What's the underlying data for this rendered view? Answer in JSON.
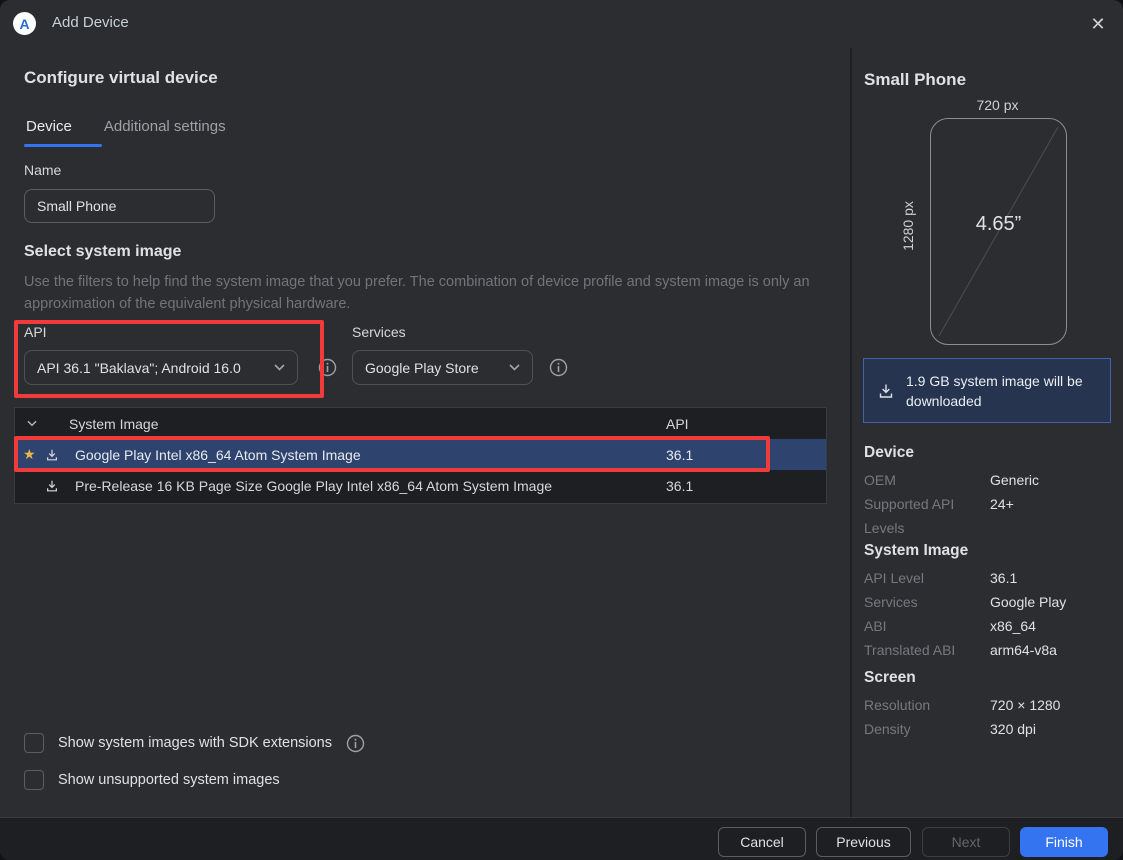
{
  "titlebar": {
    "title": "Add Device",
    "close_icon": "✕",
    "logo_letter": "A"
  },
  "header": {
    "heading": "Configure virtual device"
  },
  "tabs": [
    {
      "label": "Device",
      "active": true
    },
    {
      "label": "Additional settings",
      "active": false
    }
  ],
  "name_field": {
    "label": "Name",
    "value": "Small Phone"
  },
  "system_image_section": {
    "heading": "Select system image",
    "description": "Use the filters to help find the system image that you prefer. The combination of device profile and system image is only an approximation of the equivalent physical hardware."
  },
  "filters": {
    "api": {
      "label": "API",
      "value": "API 36.1 \"Baklava\"; Android 16.0"
    },
    "services": {
      "label": "Services",
      "value": "Google Play Store"
    }
  },
  "table": {
    "columns": {
      "system_image": "System Image",
      "api": "API"
    },
    "rows": [
      {
        "name": "Google Play Intel x86_64 Atom System Image",
        "api": "36.1",
        "selected": true,
        "starred": true
      },
      {
        "name": "Pre-Release 16 KB Page Size Google Play Intel x86_64 Atom System Image",
        "api": "36.1",
        "selected": false,
        "starred": false
      }
    ]
  },
  "checkboxes": [
    {
      "label": "Show system images with SDK extensions",
      "checked": false
    },
    {
      "label": "Show unsupported system images",
      "checked": false
    }
  ],
  "footer": {
    "cancel": "Cancel",
    "previous": "Previous",
    "next": "Next",
    "finish": "Finish"
  },
  "details_panel": {
    "title": "Small Phone",
    "diagram": {
      "width_label": "720 px",
      "height_label": "1280 px",
      "diagonal_label": "4.65”"
    },
    "download_note": "1.9 GB system image will be downloaded",
    "sections": [
      {
        "heading": "Device",
        "rows": [
          [
            "OEM",
            "Generic"
          ],
          [
            "Supported API Levels",
            "24+"
          ]
        ]
      },
      {
        "heading": "System Image",
        "rows": [
          [
            "API Level",
            "36.1"
          ],
          [
            "Services",
            "Google Play"
          ],
          [
            "ABI",
            "x86_64"
          ],
          [
            "Translated ABI",
            "arm64-v8a"
          ]
        ]
      },
      {
        "heading": "Screen",
        "rows": [
          [
            "Resolution",
            "720 × 1280"
          ],
          [
            "Density",
            "320 dpi"
          ]
        ]
      }
    ]
  },
  "colors": {
    "accent": "#3574f0",
    "annotation_red": "#f13b3b",
    "selected_row": "#2e436e",
    "star": "#eab64c",
    "background": "#2b2d30",
    "surface_dark": "#1e1f22"
  }
}
